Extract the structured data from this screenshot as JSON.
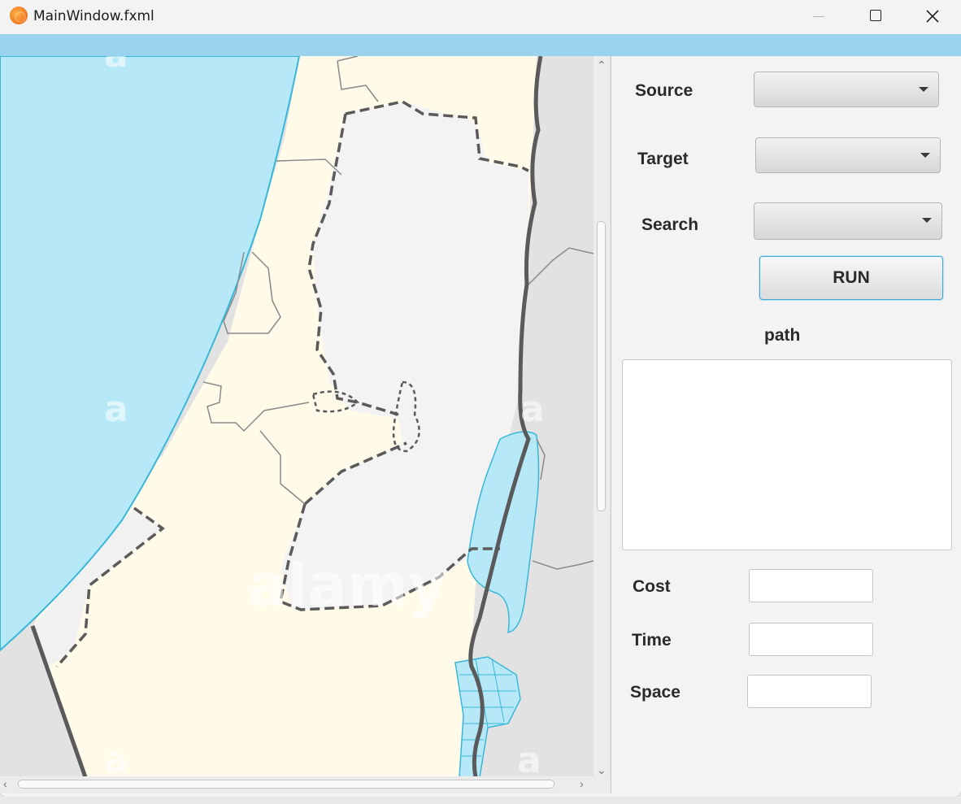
{
  "window": {
    "title": "MainWindow.fxml",
    "icon": "app-logo-icon",
    "controls": [
      "minimize-icon",
      "maximize-icon",
      "close-icon"
    ]
  },
  "map": {
    "watermark_letter": "a",
    "watermark_word": "alamy",
    "colors": {
      "sea": "#b7e8f8",
      "land": "#fffbe8",
      "region": "#f2f2f2",
      "outside": "#e2e2e2",
      "border": "#5a5a5a"
    }
  },
  "form": {
    "source_label": "Source",
    "target_label": "Target",
    "search_label": "Search",
    "source_value": "",
    "target_value": "",
    "search_value": "",
    "run_label": "RUN",
    "path_label": "path",
    "path_value": "",
    "cost_label": "Cost",
    "time_label": "Time",
    "space_label": "Space",
    "cost_value": "",
    "time_value": "",
    "space_value": ""
  },
  "colors": {
    "accent": "#9ad3ee",
    "button_focus": "#3fa9d8"
  }
}
